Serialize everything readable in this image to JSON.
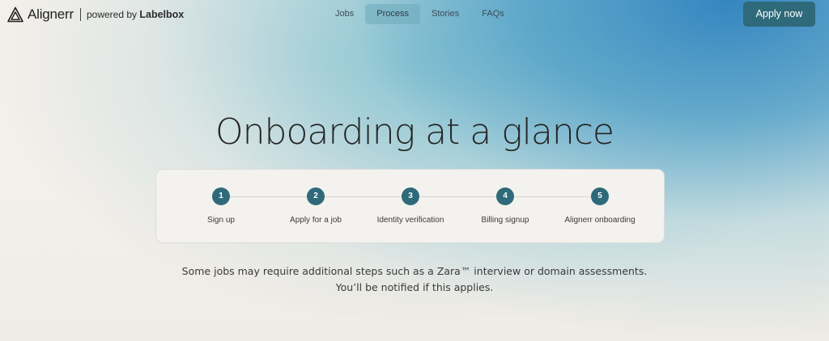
{
  "header": {
    "brand_name": "Alignerr",
    "powered_prefix": "powered by",
    "powered_brand": "Labelbox",
    "nav": [
      {
        "label": "Jobs",
        "active": false
      },
      {
        "label": "Process",
        "active": true
      },
      {
        "label": "Stories",
        "active": false
      },
      {
        "label": "FAQs",
        "active": false
      }
    ],
    "cta_label": "Apply now",
    "logo_icon": "triangle-logo-icon"
  },
  "main": {
    "title": "Onboarding at a glance",
    "steps": [
      {
        "number": "1",
        "label": "Sign up"
      },
      {
        "number": "2",
        "label": "Apply for a job"
      },
      {
        "number": "3",
        "label": "Identity verification"
      },
      {
        "number": "4",
        "label": "Billing signup"
      },
      {
        "number": "5",
        "label": "Alignerr onboarding"
      }
    ],
    "note_line1": "Some jobs may require additional steps such as a Zara™ interview or domain assessments.",
    "note_line2": "You’ll be notified if this applies."
  },
  "colors": {
    "accent": "#2f6a7b",
    "active_nav_bg": "#8fc0c9",
    "background": "#f3efea"
  }
}
